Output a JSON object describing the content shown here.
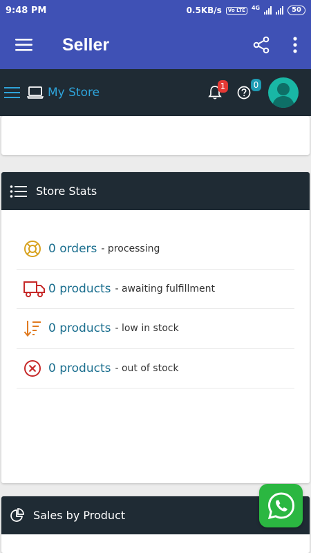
{
  "status_bar": {
    "time": "9:48 PM",
    "net_speed": "0.5KB/s",
    "volte": "Vo LTE",
    "network": "4G",
    "battery": "50"
  },
  "app_bar": {
    "title": "Seller",
    "icons": [
      "menu-icon",
      "share-icon",
      "more-vert-icon"
    ]
  },
  "store_header": {
    "title": "My Store",
    "notifications_count": "1",
    "help_count": "0",
    "icons": [
      "hamburger-icon",
      "laptop-icon",
      "bell-icon",
      "question-icon",
      "avatar"
    ]
  },
  "store_stats": {
    "title": "Store Stats",
    "rows": [
      {
        "count": "0 orders",
        "desc": "- processing",
        "icon": "lifebuoy-icon",
        "color": "#d8a21f"
      },
      {
        "count": "0 products",
        "desc": "- awaiting fulfillment",
        "icon": "truck-icon",
        "color": "#c62828"
      },
      {
        "count": "0 products",
        "desc": "- low in stock",
        "icon": "sort-descending-icon",
        "color": "#e07a1f"
      },
      {
        "count": "0 products",
        "desc": "- out of stock",
        "icon": "x-circle-icon",
        "color": "#c62828"
      }
    ]
  },
  "sales_by_product": {
    "title": "Sales by Product",
    "icon": "pie-chart-icon"
  },
  "colors": {
    "primary": "#3f51b5",
    "header_dark": "#1f2b34",
    "accent": "#2ea3d9",
    "stat_text": "#1a6e8e",
    "whatsapp": "#2bb741"
  }
}
